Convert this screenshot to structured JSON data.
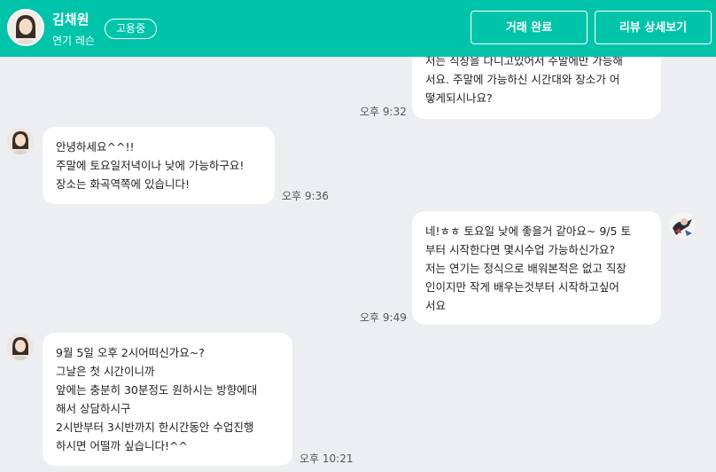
{
  "header": {
    "name": "김채원",
    "subtitle": "연기 레슨",
    "badge": "고용중",
    "complete_button": "거래 완료",
    "review_button": "리뷰 상세보기"
  },
  "messages": [
    {
      "sender": "me",
      "lines": [
        "저는 직장을 다니고있어서 주말에만 가능해",
        "서요. 주말에 가능하신 시간대와 장소가 어",
        "떻게되시나요?"
      ],
      "time": "오후 9:32"
    },
    {
      "sender": "other",
      "lines": [
        "안녕하세요^^!!",
        "주말에 토요일저녁이나 낮에 가능하구요!",
        "장소는 화곡역쪽에 있습니다!"
      ],
      "time": "오후 9:36"
    },
    {
      "sender": "me",
      "lines": [
        "네!ㅎㅎ 토요일 낮에 좋을거 같아요~ 9/5 토",
        "부터 시작한다면 몇시수업 가능하신가요?",
        "저는 연기는 정식으로 배워본적은 없고 직장",
        "인이지만 작게 배우는것부터 시작하고싶어",
        "서요"
      ],
      "time": "오후 9:49"
    },
    {
      "sender": "other",
      "lines": [
        "9월 5일 오후 2시어떠신가요~?",
        "그날은 첫 시간이니까",
        "앞에는 충분히 30분정도 원하시는 방향에대",
        "해서 상담하시구",
        "2시반부터 3시반까지 한시간동안 수업진행",
        "하시면 어떨까 싶습니다!^^"
      ],
      "time": "오후 10:21"
    }
  ]
}
